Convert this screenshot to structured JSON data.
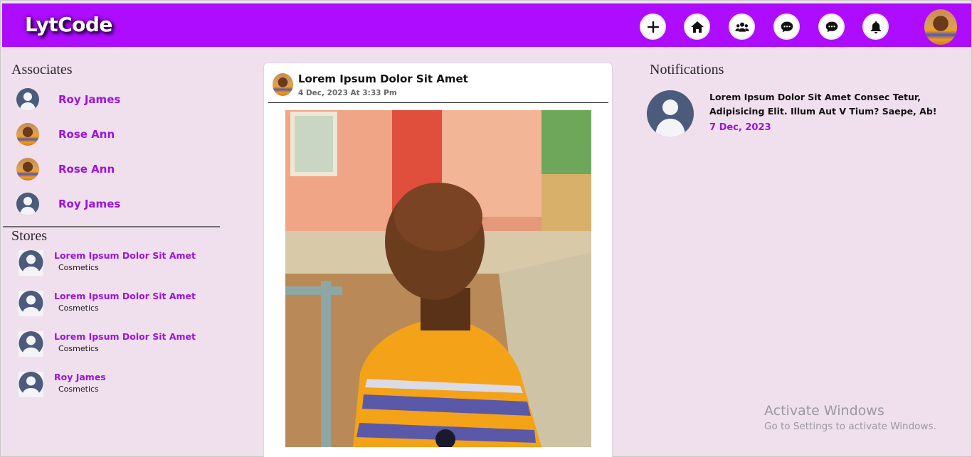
{
  "app": {
    "logo": "LytCode"
  },
  "header": {
    "nav": [
      {
        "icon": "plus-icon"
      },
      {
        "icon": "home-icon"
      },
      {
        "icon": "users-icon"
      },
      {
        "icon": "chat-icon"
      },
      {
        "icon": "chat-icon"
      },
      {
        "icon": "bell-icon"
      }
    ],
    "accent_color": "#ad0cff"
  },
  "associates": {
    "title": "Associates",
    "items": [
      {
        "name": "Roy James",
        "avatar": "default-avatar"
      },
      {
        "name": "Rose Ann",
        "avatar": "photo-avatar"
      },
      {
        "name": "Rose Ann",
        "avatar": "photo-avatar"
      },
      {
        "name": "Roy James",
        "avatar": "default-avatar"
      }
    ]
  },
  "stores": {
    "title": "Stores",
    "items": [
      {
        "name": "Lorem Ipsum Dolor Sit Amet",
        "category": "Cosmetics"
      },
      {
        "name": "Lorem Ipsum Dolor Sit Amet",
        "category": "Cosmetics"
      },
      {
        "name": "Lorem Ipsum Dolor Sit Amet",
        "category": "Cosmetics"
      },
      {
        "name": "Roy James",
        "category": "Cosmetics"
      }
    ]
  },
  "post": {
    "title": "Lorem Ipsum Dolor Sit Amet",
    "date": "4 Dec, 2023 At 3:33 Pm"
  },
  "notifications": {
    "title": "Notifications",
    "items": [
      {
        "text": "Lorem Ipsum Dolor Sit Amet Consec Tetur, Adipisicing Elit. Illum Aut V Tium? Saepe, Ab!",
        "date": "7 Dec, 2023"
      }
    ]
  },
  "watermark": {
    "title": "Activate Windows",
    "subtitle": "Go to Settings to activate Windows."
  }
}
